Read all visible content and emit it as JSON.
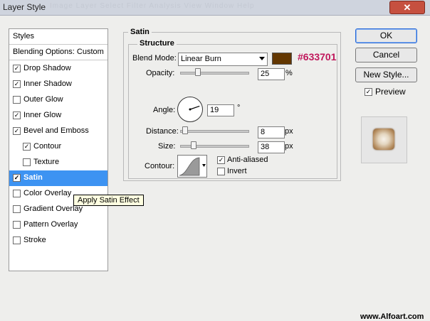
{
  "window": {
    "title": "Layer Style",
    "ghost_menu": "Image   Layer   Select   Filter   Analysis   View   Window   Help",
    "close_glyph": "✕"
  },
  "panel": {
    "header": "Styles",
    "blending": "Blending Options: Custom",
    "items": [
      {
        "label": "Drop Shadow",
        "checked": true
      },
      {
        "label": "Inner Shadow",
        "checked": true
      },
      {
        "label": "Outer Glow",
        "checked": false
      },
      {
        "label": "Inner Glow",
        "checked": true
      },
      {
        "label": "Bevel and Emboss",
        "checked": true
      },
      {
        "label": "Contour",
        "checked": true
      },
      {
        "label": "Texture",
        "checked": false
      },
      {
        "label": "Satin",
        "checked": true
      },
      {
        "label": "Color Overlay",
        "checked": false
      },
      {
        "label": "Gradient Overlay",
        "checked": false
      },
      {
        "label": "Pattern Overlay",
        "checked": false
      },
      {
        "label": "Stroke",
        "checked": false
      }
    ]
  },
  "tooltip": "Apply Satin Effect",
  "satin": {
    "title": "Satin",
    "structure_title": "Structure",
    "blend_mode_label": "Blend Mode:",
    "blend_mode_value": "Linear Burn",
    "color": "#633701",
    "color_hex_text": "#633701",
    "opacity_label": "Opacity:",
    "opacity_value": "25",
    "opacity_unit": "%",
    "opacity_fraction": 0.25,
    "angle_label": "Angle:",
    "angle_value": "19",
    "angle_unit": "°",
    "distance_label": "Distance:",
    "distance_value": "8",
    "distance_unit": "px",
    "size_label": "Size:",
    "size_value": "38",
    "size_unit": "px",
    "contour_label": "Contour:",
    "anti_aliased_label": "Anti-aliased",
    "anti_aliased_checked": true,
    "invert_label": "Invert",
    "invert_checked": false
  },
  "buttons": {
    "ok": "OK",
    "cancel": "Cancel",
    "new_style": "New Style..."
  },
  "preview": {
    "label": "Preview",
    "checked": true
  },
  "watermark": "www.Alfoart.com",
  "check_glyph": "✓"
}
